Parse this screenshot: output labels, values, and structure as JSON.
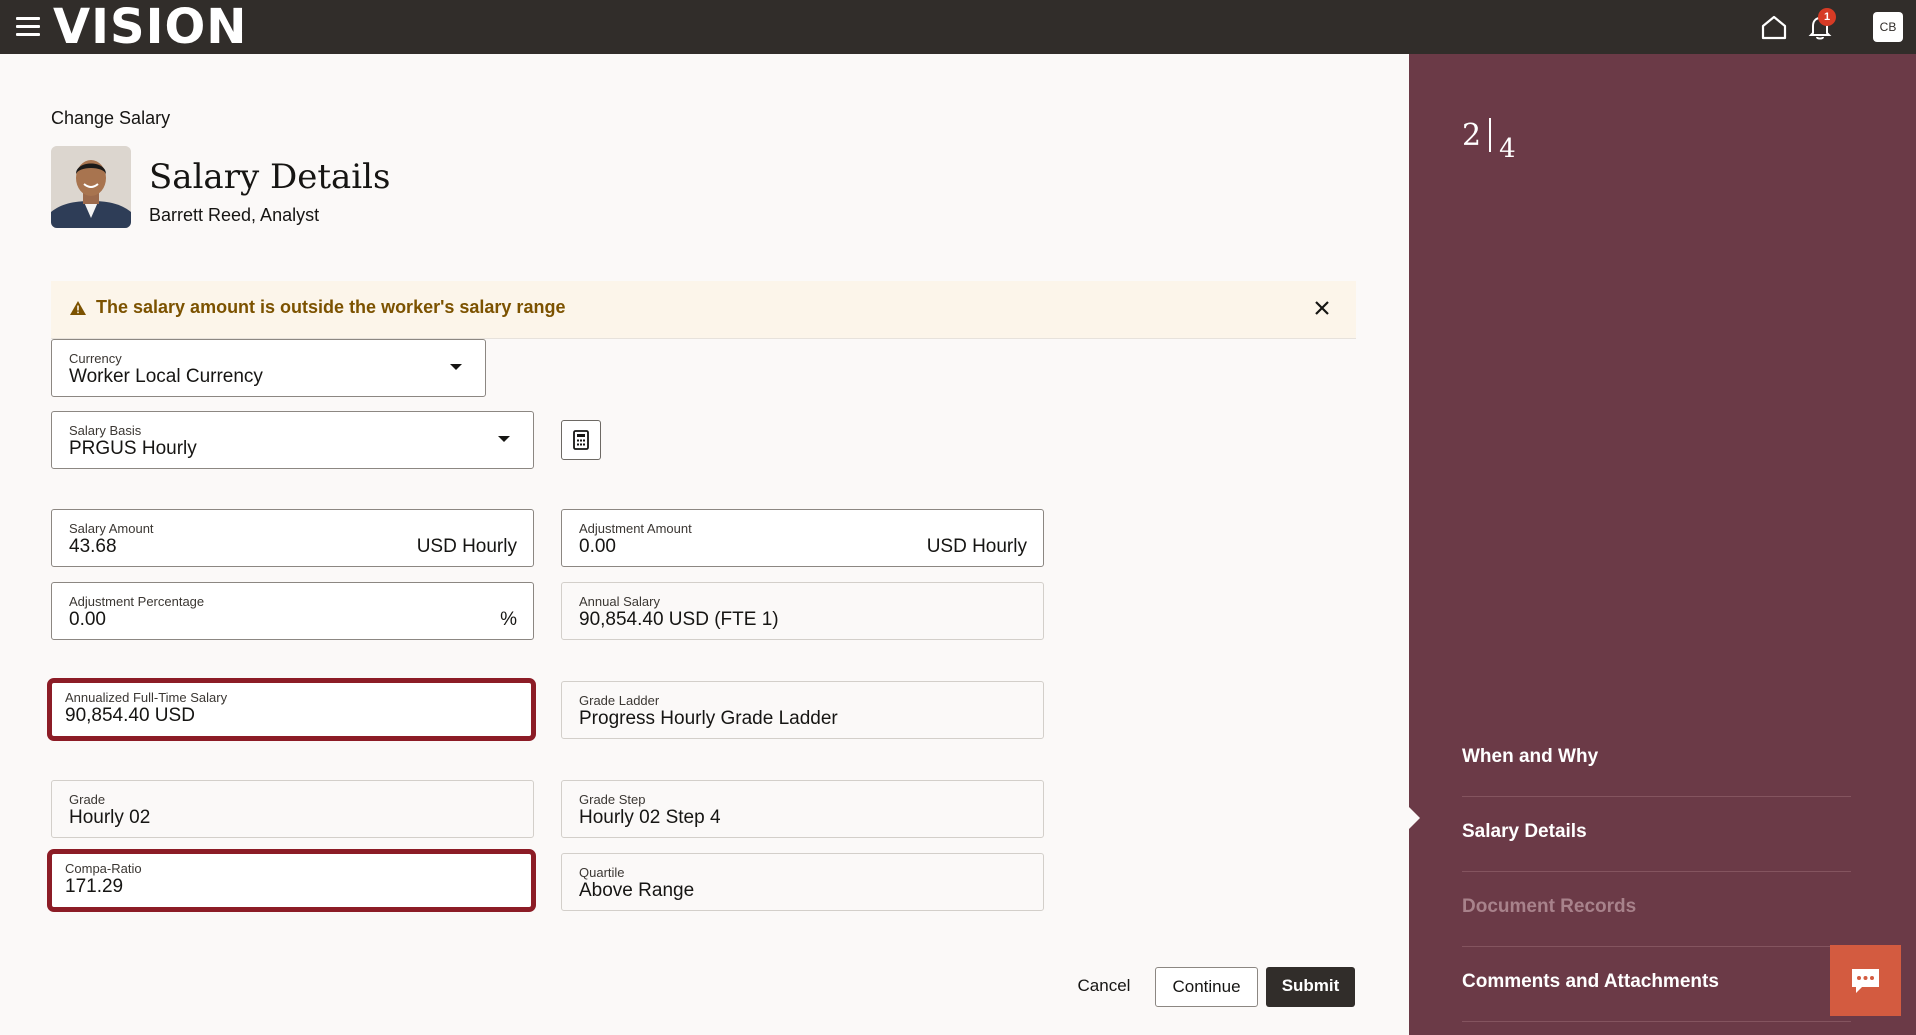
{
  "app": {
    "logo": "VISION",
    "notification_count": "1",
    "user_initials": "CB"
  },
  "page": {
    "breadcrumb": "Change Salary",
    "title": "Salary Details",
    "worker": "Barrett Reed, Analyst"
  },
  "warning": {
    "message": "The salary amount is outside the worker's salary range"
  },
  "fields": {
    "currency": {
      "label": "Currency",
      "value": "Worker Local Currency"
    },
    "salary_basis": {
      "label": "Salary Basis",
      "value": "PRGUS Hourly"
    },
    "salary_amount": {
      "label": "Salary Amount",
      "value": "43.68",
      "suffix": "USD Hourly"
    },
    "adjustment_amount": {
      "label": "Adjustment Amount",
      "value": "0.00",
      "suffix": "USD Hourly"
    },
    "adjustment_percentage": {
      "label": "Adjustment Percentage",
      "value": "0.00",
      "suffix": "%"
    },
    "annual_salary": {
      "label": "Annual Salary",
      "value": "90,854.40 USD (FTE 1)"
    },
    "annualized_salary": {
      "label": "Annualized Full-Time Salary",
      "value": "90,854.40 USD"
    },
    "grade_ladder": {
      "label": "Grade Ladder",
      "value": "Progress Hourly Grade Ladder"
    },
    "grade": {
      "label": "Grade",
      "value": "Hourly 02"
    },
    "grade_step": {
      "label": "Grade Step",
      "value": "Hourly 02 Step 4"
    },
    "compa_ratio": {
      "label": "Compa-Ratio",
      "value": "171.29"
    },
    "quartile": {
      "label": "Quartile",
      "value": "Above Range"
    }
  },
  "actions": {
    "cancel": "Cancel",
    "continue": "Continue",
    "submit": "Submit"
  },
  "steps": {
    "current": "2",
    "total": "4",
    "items": [
      {
        "label": "When and Why"
      },
      {
        "label": "Salary Details"
      },
      {
        "label": "Document Records"
      },
      {
        "label": "Comments and Attachments"
      }
    ]
  },
  "colors": {
    "topbar": "#312d2a",
    "side_panel": "#6b3a47",
    "highlight_border": "#8c1c26",
    "chat_button": "#d35b40"
  }
}
